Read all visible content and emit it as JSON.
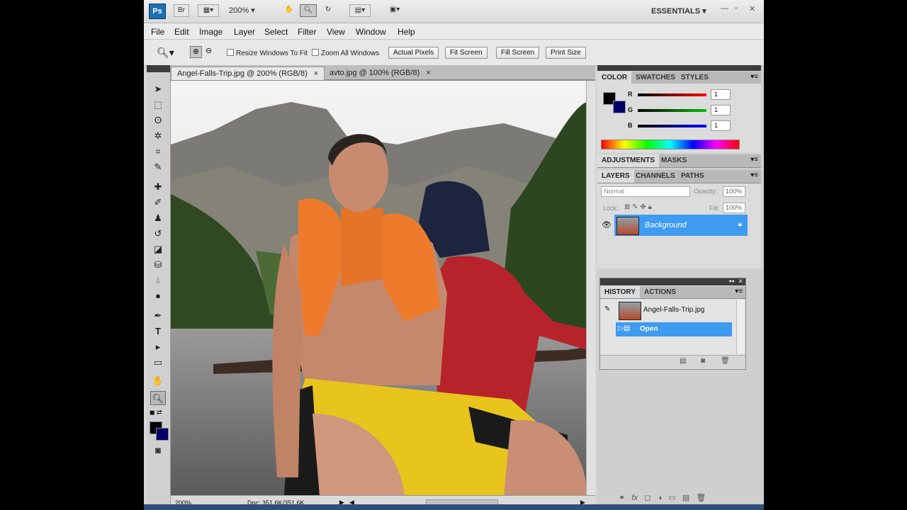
{
  "appbar": {
    "logo": "Ps",
    "bridge": "Br",
    "zoom": "200%",
    "workspace": "ESSENTIALS",
    "caret": "▾"
  },
  "menu": [
    "File",
    "Edit",
    "Image",
    "Layer",
    "Select",
    "Filter",
    "View",
    "Window",
    "Help"
  ],
  "options": {
    "resize_windows": "Resize Windows To Fit",
    "zoom_all": "Zoom All Windows",
    "actual_pixels": "Actual Pixels",
    "fit_screen": "Fit Screen",
    "fill_screen": "Fill Screen",
    "print_size": "Print Size"
  },
  "tabs": [
    {
      "label": "Angel-Falls-Trip.jpg @ 200% (RGB/8)",
      "close": "×"
    },
    {
      "label": "avto.jpg @ 100% (RGB/8)",
      "close": "×"
    }
  ],
  "status": {
    "zoom": "200%",
    "doc": "Doc: 351,6K/351,6K"
  },
  "color_panel": {
    "tabs": [
      "COLOR",
      "SWATCHES",
      "STYLES"
    ],
    "sliders": [
      {
        "label": "R",
        "value": "1",
        "color": "#ff0000"
      },
      {
        "label": "G",
        "value": "1",
        "color": "#00c000"
      },
      {
        "label": "B",
        "value": "1",
        "color": "#0000ff"
      }
    ]
  },
  "adjust_tabs": [
    "ADJUSTMENTS",
    "MASKS"
  ],
  "layers_panel": {
    "tabs": [
      "LAYERS",
      "CHANNELS",
      "PATHS"
    ],
    "blend_mode": "Normal",
    "opacity_label": "Opacity:",
    "opacity_value": "100%",
    "lock_label": "Lock:",
    "fill_label": "Fill:",
    "fill_value": "100%",
    "layer_name": "Background"
  },
  "history_panel": {
    "tabs": [
      "HISTORY",
      "ACTIONS"
    ],
    "snapshot": "Angel-Falls-Trip.jpg",
    "step": "Open"
  },
  "colors": {
    "selection_blue": "#3f9bf0",
    "ps_blue": "#1c6fb3"
  }
}
